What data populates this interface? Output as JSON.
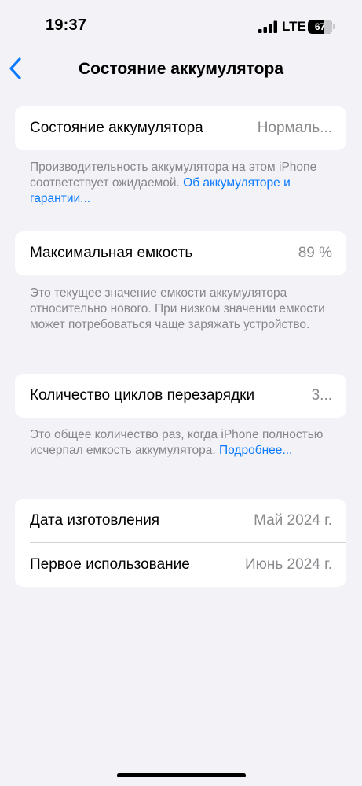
{
  "status_bar": {
    "time": "19:37",
    "network": "LTE",
    "battery_percent": "67",
    "battery_level": 0.67,
    "signal_bars": 4
  },
  "nav": {
    "back_icon": "chevron-left-icon",
    "title": "Состояние аккумулятора"
  },
  "sections": {
    "health": {
      "label": "Состояние аккумулятора",
      "value": "Нормаль...",
      "footnote_text": "Производительность аккумулятора на этом iPhone соответствует ожидаемой. ",
      "footnote_link": "Об аккумуляторе и гарантии..."
    },
    "capacity": {
      "label": "Максимальная емкость",
      "value": "89 %",
      "footnote_text": "Это текущее значение емкости аккумулятора относительно нового. При низком значении емкости может потребоваться чаще заряжать устройство."
    },
    "cycles": {
      "label": "Количество циклов перезарядки",
      "value": "3...",
      "footnote_text": "Это общее количество раз, когда iPhone полностью исчерпал емкость аккумулятора. ",
      "footnote_link": "Подробнее..."
    },
    "dates": {
      "manufacture_label": "Дата изготовления",
      "manufacture_value": "Май 2024 г.",
      "first_use_label": "Первое использование",
      "first_use_value": "Июнь 2024 г."
    }
  },
  "colors": {
    "background": "#f2f2f7",
    "card": "#ffffff",
    "accent": "#0a7aff",
    "secondary_text": "#8a8a8e"
  }
}
